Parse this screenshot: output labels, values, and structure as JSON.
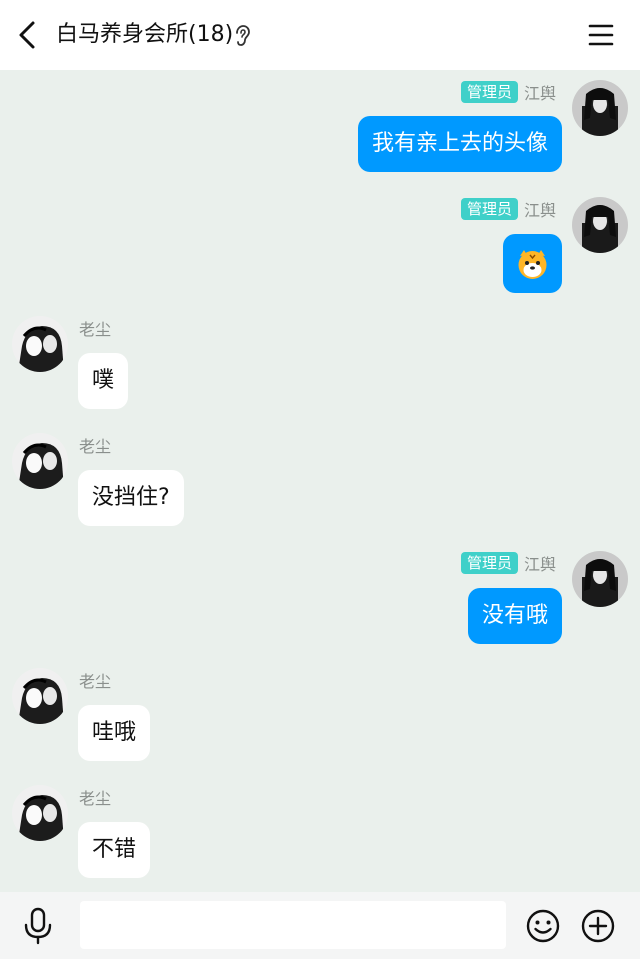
{
  "header": {
    "title": "白马养身会所(18)",
    "back_icon": "chevron-left-icon",
    "ear_icon": "ear-icon",
    "menu_icon": "hamburger-menu-icon"
  },
  "messages": [
    {
      "side": "out",
      "badge": "管理员",
      "sender": "江舆",
      "text": "我有亲上去的头像"
    },
    {
      "side": "out",
      "badge": "管理员",
      "sender": "江舆",
      "text": "",
      "sticker": "tiger-face-emoji"
    },
    {
      "side": "in",
      "sender": "老尘",
      "text": "噗"
    },
    {
      "side": "in",
      "sender": "老尘",
      "text": "没挡住?"
    },
    {
      "side": "out",
      "badge": "管理员",
      "sender": "江舆",
      "text": "没有哦"
    },
    {
      "side": "in",
      "sender": "老尘",
      "text": "哇哦"
    },
    {
      "side": "in",
      "sender": "老尘",
      "text": "不错"
    }
  ],
  "input_bar": {
    "placeholder": "",
    "mic_icon": "microphone-icon",
    "emoji_icon": "smiley-icon",
    "plus_icon": "plus-circle-icon"
  },
  "colors": {
    "background": "#eaf0ec",
    "outgoing_bubble": "#0099ff",
    "incoming_bubble": "#ffffff",
    "admin_badge": "#3fd0c9"
  }
}
